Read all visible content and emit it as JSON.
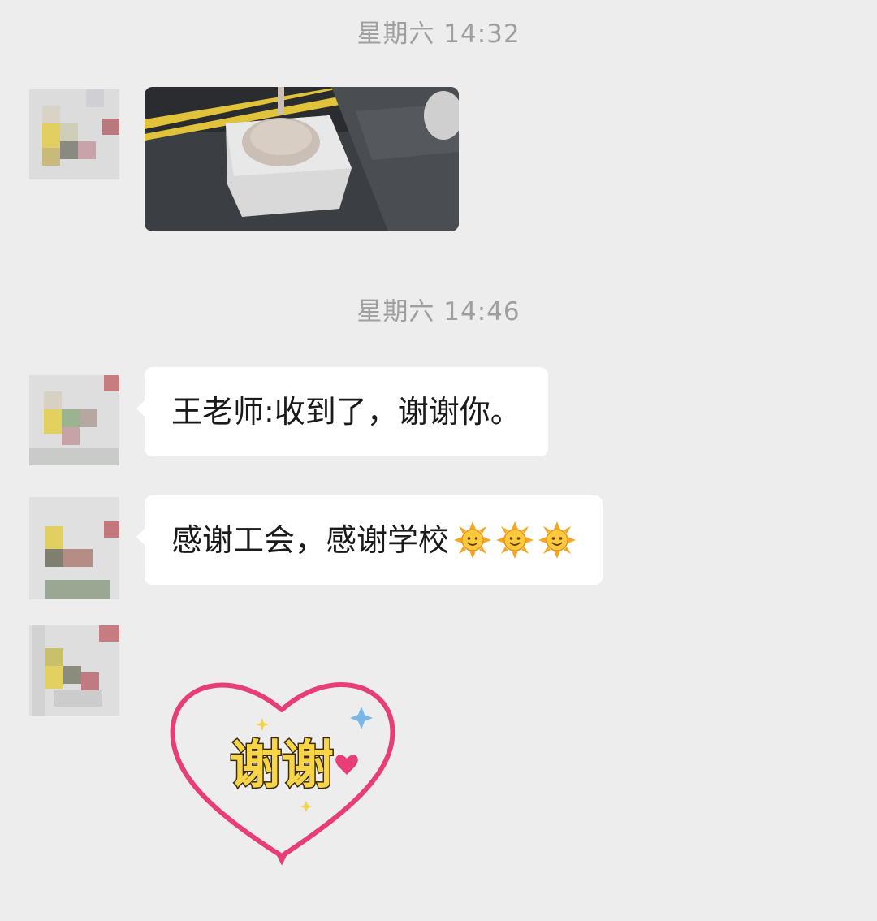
{
  "chat": {
    "timestamps": [
      "星期六 14:32",
      "星期六 14:46"
    ],
    "messages": [
      {
        "type": "image",
        "description_icon": "photo-package-icon"
      },
      {
        "type": "text",
        "text": "王老师:收到了，谢谢你。"
      },
      {
        "type": "text",
        "text": "感谢工会，感谢学校",
        "emoji": [
          "sun-emoji",
          "sun-emoji",
          "sun-emoji"
        ]
      },
      {
        "type": "sticker",
        "text": "谢谢"
      }
    ]
  },
  "colors": {
    "background": "#ededed",
    "bubble": "#ffffff",
    "timestamp": "#9f9f9f",
    "heart": "#e83e78",
    "sticker_text": "#f7d547"
  }
}
